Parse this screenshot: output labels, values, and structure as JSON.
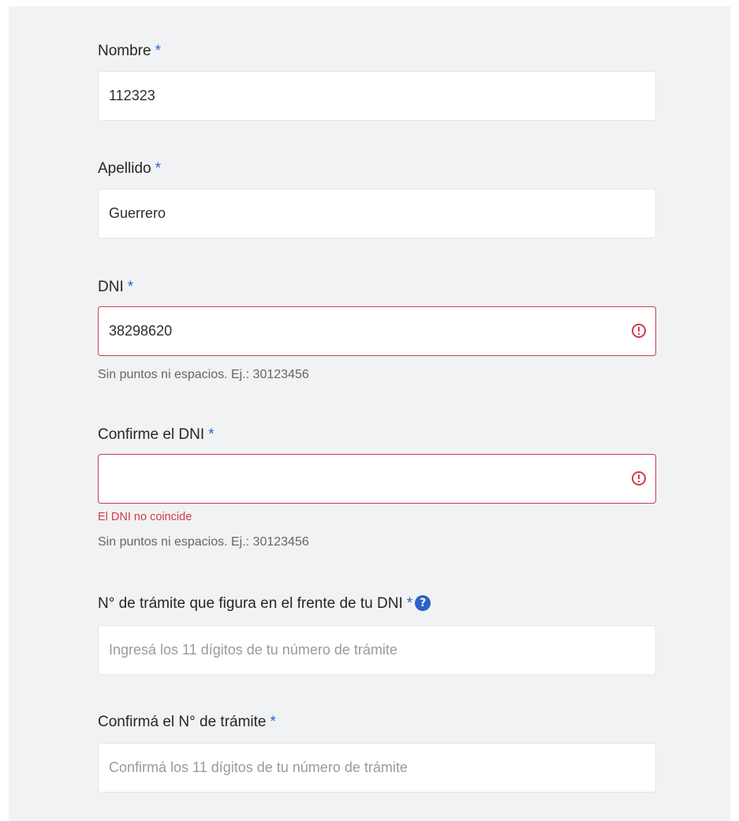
{
  "form": {
    "nombre": {
      "label": "Nombre",
      "required_mark": "*",
      "value": "112323"
    },
    "apellido": {
      "label": "Apellido",
      "required_mark": "*",
      "value": "Guerrero"
    },
    "dni": {
      "label": "DNI",
      "required_mark": "*",
      "value": "38298620",
      "hint": "Sin puntos ni espacios. Ej.: 30123456",
      "state": "error"
    },
    "confirm_dni": {
      "label": "Confirme el DNI",
      "required_mark": "*",
      "value": "",
      "error": "El DNI no coincide",
      "hint": "Sin puntos ni espacios. Ej.: 30123456",
      "state": "error"
    },
    "tramite": {
      "label": "N° de trámite que figura en el frente de tu DNI",
      "required_mark": "*",
      "help_icon": "?",
      "placeholder": "Ingresá los 11 dígitos de tu número de trámite"
    },
    "confirm_tramite": {
      "label": "Confirmá el N° de trámite",
      "required_mark": "*",
      "placeholder": "Confirmá los 11 dígitos de tu número de trámite"
    }
  },
  "colors": {
    "required": "#2f62c7",
    "error": "#d23b48",
    "panel_background": "#f1f2f4"
  }
}
